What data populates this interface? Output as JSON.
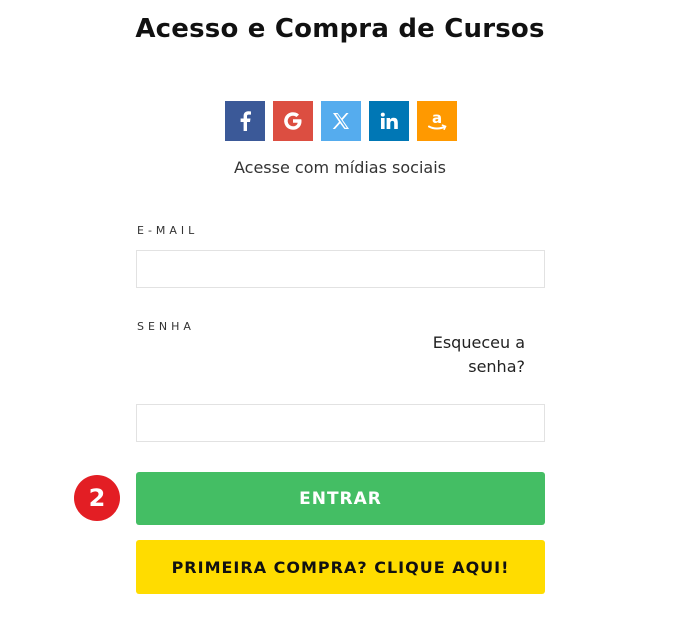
{
  "header": {
    "title": "Acesso e Compra de Cursos"
  },
  "social": {
    "buttons": [
      {
        "name": "facebook",
        "icon": "facebook-icon",
        "color": "#3b5998"
      },
      {
        "name": "google",
        "icon": "google-icon",
        "color": "#dc4e41"
      },
      {
        "name": "x",
        "icon": "x-icon",
        "color": "#55acee"
      },
      {
        "name": "linkedin",
        "icon": "linkedin-icon",
        "color": "#0077b5"
      },
      {
        "name": "amazon",
        "icon": "amazon-icon",
        "color": "#ff9900"
      }
    ],
    "caption": "Acesse com mídias sociais"
  },
  "form": {
    "email_label": "E-MAIL",
    "email_value": "",
    "password_label": "SENHA",
    "password_value": "",
    "forgot_line1": "Esqueceu a",
    "forgot_line2": "senha?"
  },
  "annotation": {
    "step_number": "2",
    "color": "#e31e24"
  },
  "buttons": {
    "enter_label": "ENTRAR",
    "enter_color": "#44be64",
    "first_purchase_label": "PRIMEIRA COMPRA? CLIQUE AQUI!",
    "first_purchase_color": "#ffdc00"
  }
}
